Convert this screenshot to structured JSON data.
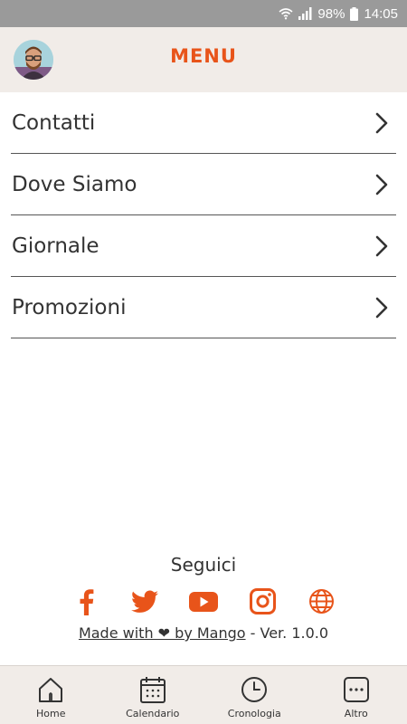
{
  "status_bar": {
    "battery": "98%",
    "time": "14:05",
    "icons": [
      "wifi-icon",
      "signal-icon",
      "battery-icon"
    ]
  },
  "header": {
    "title": "MENU",
    "avatar": "user-avatar"
  },
  "menu": {
    "items": [
      {
        "label": "Contatti"
      },
      {
        "label": "Dove Siamo"
      },
      {
        "label": "Giornale"
      },
      {
        "label": "Promozioni"
      }
    ]
  },
  "follow": {
    "title": "Seguici",
    "social": [
      "facebook-icon",
      "twitter-icon",
      "youtube-icon",
      "instagram-icon",
      "website-icon"
    ],
    "made_with": "Made with ❤ by Mango",
    "version": " - Ver. 1.0.0"
  },
  "bottom_nav": {
    "items": [
      {
        "label": "Home",
        "icon": "home-icon"
      },
      {
        "label": "Calendario",
        "icon": "calendar-icon"
      },
      {
        "label": "Cronologia",
        "icon": "clock-icon"
      },
      {
        "label": "Altro",
        "icon": "more-icon"
      }
    ]
  },
  "colors": {
    "accent": "#e8541a",
    "header_bg": "#f1ece8",
    "status_bg": "#9a9a9a",
    "text": "#333333"
  }
}
